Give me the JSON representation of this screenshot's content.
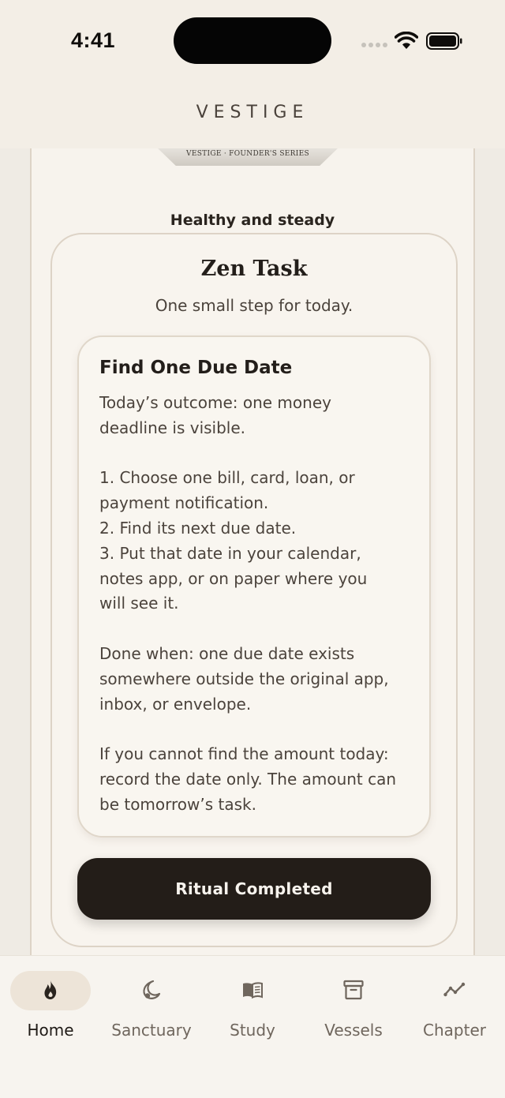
{
  "status_bar": {
    "time": "4:41"
  },
  "header": {
    "title": "VESTIGE"
  },
  "card_peek": {
    "label": "VESTIGE · FOUNDER'S SERIES"
  },
  "health_status": "Healthy and steady",
  "task": {
    "title": "Zen Task",
    "subtitle": "One small step for today.",
    "instruction_title": "Find One Due Date",
    "lines": {
      "l1": "Today’s outcome: one money",
      "l2": "deadline is visible.",
      "l3": "1. Choose one bill, card, loan, or",
      "l4": "payment notification.",
      "l5": "2. Find its next due date.",
      "l6": "3. Put that date in your calendar,",
      "l7": "notes app, or on paper where you",
      "l8": "will see it.",
      "l9": "Done when: one due date exists",
      "l10": "somewhere outside the original app,",
      "l11": "inbox, or envelope.",
      "l12": "If you cannot find the amount today:",
      "l13": "record the date only. The amount can",
      "l14": "be tomorrow’s task."
    },
    "button_label": "Ritual Completed"
  },
  "tabs": [
    {
      "label": "Home",
      "icon": "flame-icon",
      "active": true
    },
    {
      "label": "Sanctuary",
      "icon": "moon-icon",
      "active": false
    },
    {
      "label": "Study",
      "icon": "book-icon",
      "active": false
    },
    {
      "label": "Vessels",
      "icon": "archive-icon",
      "active": false
    },
    {
      "label": "Chapter",
      "icon": "trend-line-icon",
      "active": false
    }
  ],
  "colors": {
    "background": "#efebe4",
    "surface": "#f7f3ed",
    "border": "#ddd3c6",
    "button": "#231d18",
    "active_tab_pill": "#ede4d8"
  }
}
